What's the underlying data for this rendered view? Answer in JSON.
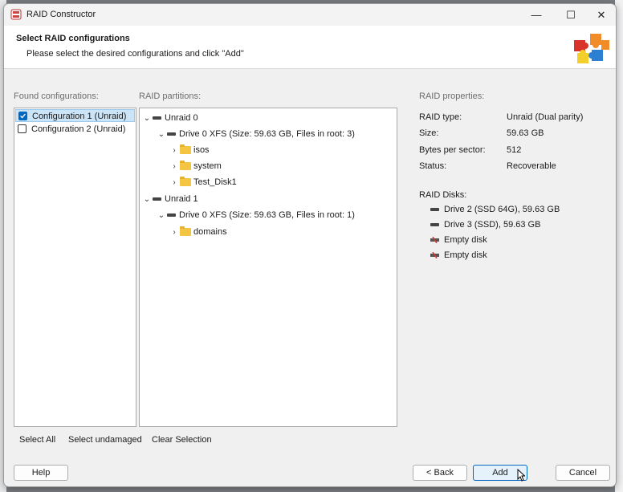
{
  "window": {
    "title": "RAID Constructor",
    "controls": {
      "minimize": "—",
      "maximize": "☐",
      "close": "✕"
    }
  },
  "header": {
    "title": "Select RAID configurations",
    "subtitle": "Please select the desired configurations and click \"Add\""
  },
  "sections": {
    "found": "Found configurations:",
    "partitions": "RAID partitions:",
    "properties": "RAID properties:"
  },
  "configurations": [
    {
      "label": "Configuration 1 (Unraid)",
      "checked": true,
      "selected": true
    },
    {
      "label": "Configuration 2 (Unraid)",
      "checked": false,
      "selected": false
    }
  ],
  "tree": {
    "nodes": [
      {
        "label": "Unraid 0",
        "chevron": "⌄"
      },
      {
        "label": "Drive 0 XFS (Size: 59.63 GB, Files in root: 3)",
        "chevron": "⌄"
      },
      {
        "label": "isos",
        "chevron": "›"
      },
      {
        "label": "system",
        "chevron": "›"
      },
      {
        "label": "Test_Disk1",
        "chevron": "›"
      },
      {
        "label": "Unraid 1",
        "chevron": "⌄"
      },
      {
        "label": "Drive 0 XFS (Size: 59.63 GB, Files in root: 1)",
        "chevron": "⌄"
      },
      {
        "label": "domains",
        "chevron": "›"
      }
    ]
  },
  "properties": {
    "items": [
      {
        "key": "RAID type:",
        "value": "Unraid (Dual parity)"
      },
      {
        "key": "Size:",
        "value": "59.63 GB"
      },
      {
        "key": "Bytes per sector:",
        "value": "512"
      },
      {
        "key": "Status:",
        "value": "Recoverable"
      }
    ],
    "disks_label": "RAID Disks:",
    "disks": [
      {
        "label": "Drive 2 (SSD 64G), 59.63 GB",
        "icon": "drive-icon"
      },
      {
        "label": "Drive 3 (SSD), 59.63 GB",
        "icon": "drive-icon"
      },
      {
        "label": "Empty disk",
        "icon": "broken-disk-icon"
      },
      {
        "label": "Empty disk",
        "icon": "broken-disk-icon"
      }
    ]
  },
  "selection_links": {
    "select_all": "Select All",
    "select_undamaged": "Select undamaged",
    "clear_selection": "Clear Selection"
  },
  "buttons": {
    "help": "Help",
    "back": "< Back",
    "add": "Add",
    "cancel": "Cancel"
  },
  "colors": {
    "accent": "#0067c0",
    "selection": "#cce4f7",
    "folder": "#f4c542"
  }
}
